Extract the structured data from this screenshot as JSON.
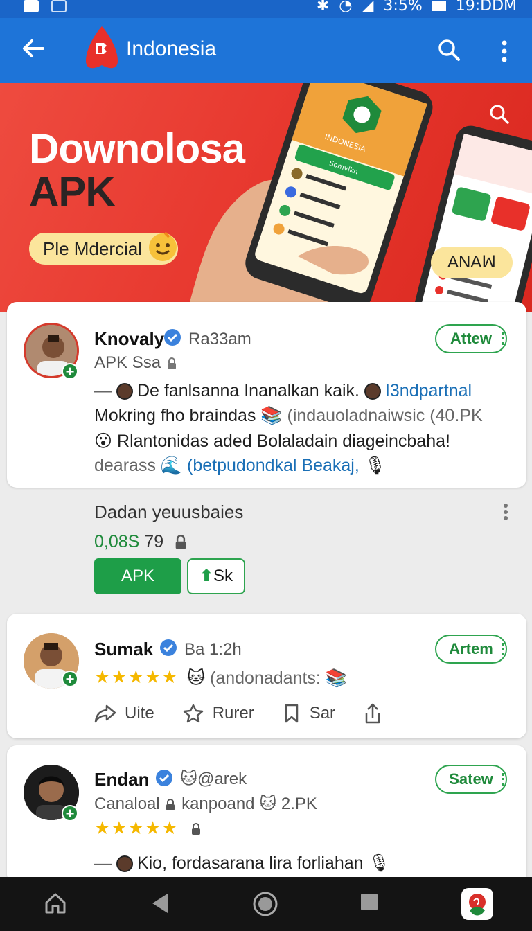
{
  "status_bar": {
    "battery": "3:5%",
    "time": "19:DDM"
  },
  "app_bar": {
    "title": "Indonesia"
  },
  "banner": {
    "headline_1": "Downolosa",
    "headline_2": "APK",
    "pill_label": "Ple Mdercial",
    "badge_label": "ANAꟽ",
    "phone_screen_title": "INDONESIA",
    "phone_screen_button": "Somvlkn"
  },
  "posts": [
    {
      "name": "Knovaly",
      "handle": "Ra33am",
      "subtitle": "APK Ssa",
      "follow_label": "Attew",
      "line1_text": "De fanlsanna Inanalkan kaik.",
      "line1_link": "I3ndpartnal",
      "line2_text": "Mokring fho braindas",
      "line2_extra": "(indauoladnaiwsic (40.PK",
      "line3_text": "Rlantonidas aded Bolaladain diageincbaha!",
      "line4_text": "dearass",
      "line4_link": "(betpudondkal Beakaj,"
    },
    {
      "name": "Sumak",
      "handle": "Ba 1:2h",
      "stars": "★★★★★",
      "extra": "(andonadants:",
      "follow_label": "Artem",
      "actions": [
        "Uite",
        "Rurer",
        "Sar"
      ]
    },
    {
      "name": "Endan",
      "handle": "@arek",
      "subtitle": "Canaloal",
      "subtitle_2": "kanpoand",
      "count": "2.PK",
      "stars": "★★★★★",
      "follow_label": "Satew",
      "line1_text": "Kio, fordasarana lira forliahan"
    }
  ],
  "mid_section": {
    "title": "Dadan yeuusbaies",
    "stat_green": "0,08S",
    "stat_value": "79",
    "primary_button": "APK",
    "secondary_button": "Sk"
  }
}
